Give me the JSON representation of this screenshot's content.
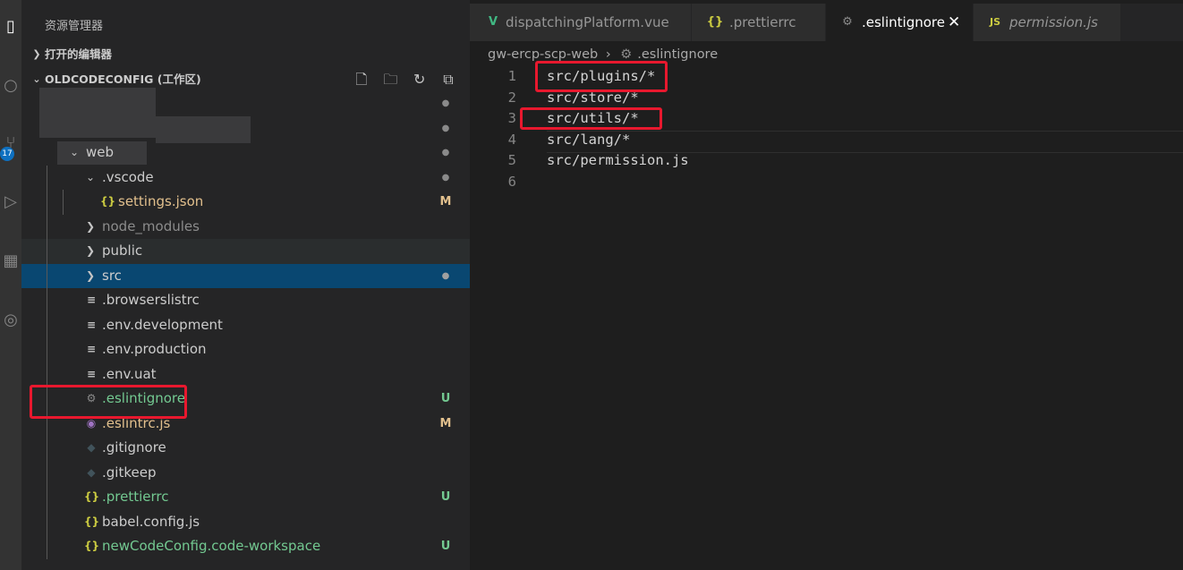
{
  "sidebar": {
    "title": "资源管理器",
    "open_editors_label": "打开的编辑器",
    "workspace_label": "OLDCODECONFIG (工作区)",
    "tree": [
      {
        "name": "",
        "type": "folder-blurred",
        "deco": "●"
      },
      {
        "name": "",
        "type": "folder-blurred",
        "deco": "●"
      },
      {
        "name": "web",
        "type": "folder-open",
        "deco": "●"
      },
      {
        "name": ".vscode",
        "type": "folder-open",
        "deco": "●"
      },
      {
        "name": "settings.json",
        "type": "json",
        "deco": "M"
      },
      {
        "name": "node_modules",
        "type": "folder",
        "deco": ""
      },
      {
        "name": "public",
        "type": "folder",
        "deco": ""
      },
      {
        "name": "src",
        "type": "folder",
        "deco": "●"
      },
      {
        "name": ".browserslistrc",
        "type": "text",
        "deco": ""
      },
      {
        "name": ".env.development",
        "type": "text",
        "deco": ""
      },
      {
        "name": ".env.production",
        "type": "text",
        "deco": ""
      },
      {
        "name": ".env.uat",
        "type": "text",
        "deco": ""
      },
      {
        "name": ".eslintignore",
        "type": "gear",
        "deco": "U"
      },
      {
        "name": ".eslintrc.js",
        "type": "eslint",
        "deco": "M"
      },
      {
        "name": ".gitignore",
        "type": "git",
        "deco": ""
      },
      {
        "name": ".gitkeep",
        "type": "git",
        "deco": ""
      },
      {
        "name": ".prettierrc",
        "type": "json",
        "deco": "U"
      },
      {
        "name": "babel.config.js",
        "type": "babel",
        "deco": ""
      },
      {
        "name": "newCodeConfig.code-workspace",
        "type": "json",
        "deco": "U"
      }
    ]
  },
  "tabs": [
    {
      "label": "dispatchingPlatform.vue",
      "icon": "V"
    },
    {
      "label": ".prettierrc",
      "icon": "{}"
    },
    {
      "label": ".eslintignore",
      "icon": "⚙",
      "close": "✕"
    },
    {
      "label": "permission.js",
      "icon": "JS"
    }
  ],
  "breadcrumb": {
    "folder": "gw-ercp-scp-web",
    "separator": "›",
    "file": ".eslintignore"
  },
  "activity": {
    "badge": "17"
  },
  "editor": {
    "lines": [
      {
        "num": "1",
        "text": "src/plugins/*"
      },
      {
        "num": "2",
        "text": "src/store/*"
      },
      {
        "num": "3",
        "text": "src/utils/*"
      },
      {
        "num": "4",
        "text": "src/lang/*"
      },
      {
        "num": "5",
        "text": "src/permission.js"
      },
      {
        "num": "6",
        "text": ""
      }
    ]
  },
  "colors": {
    "untracked": "#73c991",
    "modified": "#e2c08d",
    "selected_row": "#094771",
    "highlight_box": "#e8182e"
  }
}
